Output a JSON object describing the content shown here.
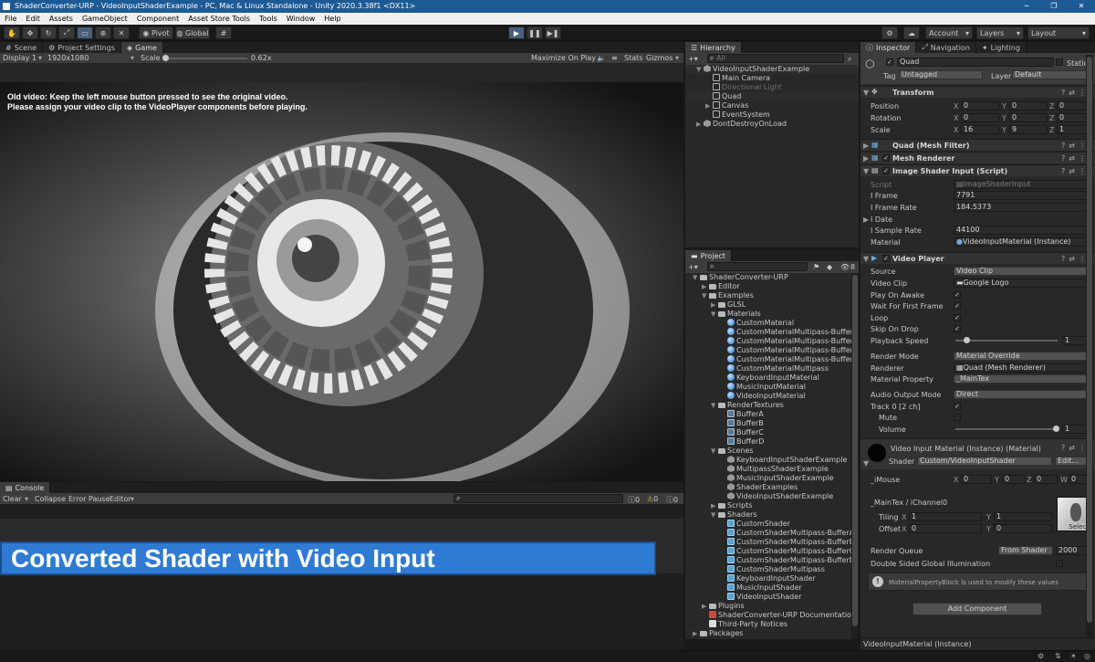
{
  "window": {
    "title": "ShaderConverter-URP - VideoInputShaderExample - PC, Mac & Linux Standalone - Unity 2020.3.38f1 <DX11>",
    "minimize": "─",
    "maximize": "❐",
    "close": "✕"
  },
  "menu": [
    "File",
    "Edit",
    "Assets",
    "GameObject",
    "Component",
    "Asset Store Tools",
    "Tools",
    "Window",
    "Help"
  ],
  "toolbar": {
    "pivot": "Pivot",
    "global": "Global",
    "play": "▶",
    "pause": "❚❚",
    "step": "▶❚",
    "account": "Account",
    "layers": "Layers",
    "layout": "Layout"
  },
  "colors": {
    "accent": "#2f7bd3",
    "titlebar": "#1c5a95",
    "selection": "#46607c"
  },
  "game_tabs": {
    "scene": "Scene",
    "project_settings": "Project Settings",
    "game": "Game"
  },
  "game_bar": {
    "display": "Display 1",
    "resolution": "1920x1080",
    "scale_label": "Scale",
    "scale_value": "0.62x",
    "maximize": "Maximize On Play",
    "stats": "Stats",
    "gizmos": "Gizmos"
  },
  "game_view": {
    "line1": "Old video: Keep the left mouse button pressed to see the original video.",
    "line2": "Please assign your video clip to the VideoPlayer components before playing."
  },
  "console": {
    "tab": "Console",
    "clear": "Clear",
    "collapse": "Collapse",
    "error_pause": "Error Pause",
    "editor": "Editor",
    "count_info": "0",
    "count_warn": "0",
    "count_error": "0"
  },
  "banner": "Converted Shader with Video Input",
  "hierarchy": {
    "tab": "Hierarchy",
    "search_placeholder": "All",
    "items": [
      {
        "label": "VideoInputShaderExample",
        "depth": 0,
        "icon": "scene",
        "caret": "▼"
      },
      {
        "label": "Main Camera",
        "depth": 1,
        "icon": "cube",
        "caret": ""
      },
      {
        "label": "Directional Light",
        "depth": 1,
        "icon": "cube",
        "caret": ""
      },
      {
        "label": "Quad",
        "depth": 1,
        "icon": "cube",
        "caret": ""
      },
      {
        "label": "Canvas",
        "depth": 1,
        "icon": "cube",
        "caret": "▶"
      },
      {
        "label": "EventSystem",
        "depth": 1,
        "icon": "cube",
        "caret": ""
      },
      {
        "label": "DontDestroyOnLoad",
        "depth": 0,
        "icon": "scene",
        "caret": "▶"
      }
    ]
  },
  "project": {
    "tab": "Project",
    "badge": "8",
    "items": [
      {
        "label": "ShaderConverter-URP",
        "depth": 0,
        "icon": "folder",
        "caret": "▼"
      },
      {
        "label": "Editor",
        "depth": 1,
        "icon": "folder",
        "caret": "▶"
      },
      {
        "label": "Examples",
        "depth": 1,
        "icon": "folder",
        "caret": "▼"
      },
      {
        "label": "GLSL",
        "depth": 2,
        "icon": "folder",
        "caret": "▶"
      },
      {
        "label": "Materials",
        "depth": 2,
        "icon": "folder",
        "caret": "▼"
      },
      {
        "label": "CustomMaterial",
        "depth": 3,
        "icon": "mat",
        "caret": ""
      },
      {
        "label": "CustomMaterialMultipass-BufferA",
        "depth": 3,
        "icon": "mat",
        "caret": ""
      },
      {
        "label": "CustomMaterialMultipass-BufferB",
        "depth": 3,
        "icon": "mat",
        "caret": ""
      },
      {
        "label": "CustomMaterialMultipass-BufferC",
        "depth": 3,
        "icon": "mat",
        "caret": ""
      },
      {
        "label": "CustomMaterialMultipass-BufferD",
        "depth": 3,
        "icon": "mat",
        "caret": ""
      },
      {
        "label": "CustomMaterialMultipass",
        "depth": 3,
        "icon": "mat",
        "caret": ""
      },
      {
        "label": "KeyboardInputMaterial",
        "depth": 3,
        "icon": "mat",
        "caret": ""
      },
      {
        "label": "MusicInputMaterial",
        "depth": 3,
        "icon": "mat",
        "caret": ""
      },
      {
        "label": "VideoInputMaterial",
        "depth": 3,
        "icon": "mat",
        "caret": ""
      },
      {
        "label": "RenderTextures",
        "depth": 2,
        "icon": "folder",
        "caret": "▼"
      },
      {
        "label": "BufferA",
        "depth": 3,
        "icon": "tex",
        "caret": ""
      },
      {
        "label": "BufferB",
        "depth": 3,
        "icon": "tex",
        "caret": ""
      },
      {
        "label": "BufferC",
        "depth": 3,
        "icon": "tex",
        "caret": ""
      },
      {
        "label": "BufferD",
        "depth": 3,
        "icon": "tex",
        "caret": ""
      },
      {
        "label": "Scenes",
        "depth": 2,
        "icon": "folder",
        "caret": "▼"
      },
      {
        "label": "KeyboardInputShaderExample",
        "depth": 3,
        "icon": "scene",
        "caret": ""
      },
      {
        "label": "MultipassShaderExample",
        "depth": 3,
        "icon": "scene",
        "caret": ""
      },
      {
        "label": "MusicInputShaderExample",
        "depth": 3,
        "icon": "scene",
        "caret": ""
      },
      {
        "label": "ShaderExamples",
        "depth": 3,
        "icon": "scene",
        "caret": ""
      },
      {
        "label": "VideoInputShaderExample",
        "depth": 3,
        "icon": "scene",
        "caret": ""
      },
      {
        "label": "Scripts",
        "depth": 2,
        "icon": "folder",
        "caret": "▶"
      },
      {
        "label": "Shaders",
        "depth": 2,
        "icon": "folder",
        "caret": "▼"
      },
      {
        "label": "CustomShader",
        "depth": 3,
        "icon": "shader",
        "caret": ""
      },
      {
        "label": "CustomShaderMultipass-BufferA",
        "depth": 3,
        "icon": "shader",
        "caret": ""
      },
      {
        "label": "CustomShaderMultipass-BufferB",
        "depth": 3,
        "icon": "shader",
        "caret": ""
      },
      {
        "label": "CustomShaderMultipass-BufferC",
        "depth": 3,
        "icon": "shader",
        "caret": ""
      },
      {
        "label": "CustomShaderMultipass-BufferD",
        "depth": 3,
        "icon": "shader",
        "caret": ""
      },
      {
        "label": "CustomShaderMultipass",
        "depth": 3,
        "icon": "shader",
        "caret": ""
      },
      {
        "label": "KeyboardInputShader",
        "depth": 3,
        "icon": "shader",
        "caret": ""
      },
      {
        "label": "MusicInputShader",
        "depth": 3,
        "icon": "shader",
        "caret": ""
      },
      {
        "label": "VideoInputShader",
        "depth": 3,
        "icon": "shader",
        "caret": ""
      },
      {
        "label": "Plugins",
        "depth": 1,
        "icon": "folder",
        "caret": "▶"
      },
      {
        "label": "ShaderConverter-URP Documentation",
        "depth": 1,
        "icon": "doc",
        "caret": ""
      },
      {
        "label": "Third-Party Notices",
        "depth": 1,
        "icon": "notes",
        "caret": ""
      },
      {
        "label": "Packages",
        "depth": 0,
        "icon": "folder",
        "caret": "▶"
      }
    ]
  },
  "inspector": {
    "tabs": {
      "inspector": "Inspector",
      "navigation": "Navigation",
      "lighting": "Lighting"
    },
    "object_name": "Quad",
    "static": "Static",
    "tag_label": "Tag",
    "tag_value": "Untagged",
    "layer_label": "Layer",
    "layer_value": "Default",
    "transform": {
      "title": "Transform",
      "rows": [
        {
          "label": "Position",
          "x": "0",
          "y": "0",
          "z": "0"
        },
        {
          "label": "Rotation",
          "x": "0",
          "y": "0",
          "z": "0"
        },
        {
          "label": "Scale",
          "x": "16",
          "y": "9",
          "z": "1"
        }
      ]
    },
    "mesh_filter": "Quad (Mesh Filter)",
    "mesh_renderer": "Mesh Renderer",
    "image_shader": {
      "title": "Image Shader Input (Script)",
      "script_label": "Script",
      "script_value": "ImageShaderInput",
      "frame_label": "I Frame",
      "frame_value": "7791",
      "frame_rate_label": "I Frame Rate",
      "frame_rate_value": "184.5373",
      "date_label": "I Date",
      "sample_rate_label": "I Sample Rate",
      "sample_rate_value": "44100",
      "material_label": "Material",
      "material_value": "VideoInputMaterial (Instance)"
    },
    "video_player": {
      "title": "Video Player",
      "source_label": "Source",
      "source_value": "Video Clip",
      "clip_label": "Video Clip",
      "clip_value": "Google Logo",
      "play_on_awake": "Play On Awake",
      "wait_first": "Wait For First Frame",
      "loop": "Loop",
      "skip_on_drop": "Skip On Drop",
      "speed_label": "Playback Speed",
      "speed_value": "1",
      "render_mode_label": "Render Mode",
      "render_mode_value": "Material Override",
      "renderer_label": "Renderer",
      "renderer_value": "Quad (Mesh Renderer)",
      "property_label": "Material Property",
      "property_value": "_MainTex",
      "audio_label": "Audio Output Mode",
      "audio_value": "Direct",
      "track_label": "Track 0 [2 ch]",
      "mute_label": "Mute",
      "volume_label": "Volume",
      "volume_value": "1"
    },
    "material": {
      "title": "Video Input Material (Instance) (Material)",
      "shader_label": "Shader",
      "shader_value": "Custom/VideoInputShader",
      "edit": "Edit...",
      "imouse_label": "_iMouse",
      "imouse": {
        "x": "0",
        "y": "0",
        "z": "0",
        "w": "0"
      },
      "maintex_label": "_MainTex / iChannel0",
      "tiling_label": "Tiling",
      "tiling_x": "1",
      "tiling_y": "1",
      "offset_label": "Offset",
      "offset_x": "0",
      "offset_y": "0",
      "select": "Select",
      "queue_label": "Render Queue",
      "queue_mode": "From Shader",
      "queue_value": "2000",
      "dsgi_label": "Double Sided Global Illumination",
      "info": "MaterialPropertyBlock is used to modify these values"
    },
    "add_component": "Add Component",
    "footer": "VideoInputMaterial (Instance)"
  }
}
